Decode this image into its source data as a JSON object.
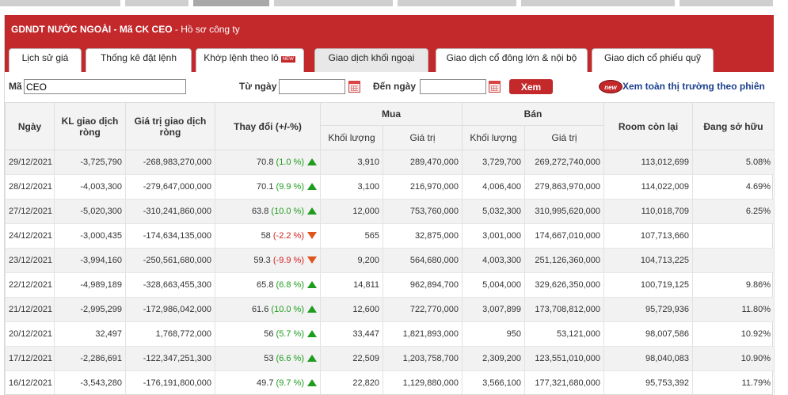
{
  "header": {
    "title": "GDNDT NƯỚC NGOÀI - Mã CK CEO",
    "subtitle": " - Hồ sơ công ty"
  },
  "tabs": [
    {
      "label": "Lịch sử giá",
      "active": false,
      "badge": ""
    },
    {
      "label": "Thống kê đặt lệnh",
      "active": false,
      "badge": ""
    },
    {
      "label": "Khớp lệnh theo lô",
      "active": false,
      "badge": "NEW"
    },
    {
      "label": "Giao dịch khối ngoại",
      "active": true,
      "badge": ""
    },
    {
      "label": "Giao dịch cổ đông lớn & nội bộ",
      "active": false,
      "badge": ""
    },
    {
      "label": "Giao dịch cổ phiếu quỹ",
      "active": false,
      "badge": ""
    }
  ],
  "filters": {
    "symbol_label": "Mã",
    "symbol_value": "CEO",
    "from_label": "Từ ngày",
    "from_value": "",
    "to_label": "Đến ngày",
    "to_value": "",
    "submit_label": "Xem",
    "new_badge": "new",
    "market_link": "Xem toàn thị trường theo phiên"
  },
  "table": {
    "headers": {
      "date": "Ngày",
      "net_volume": "KL giao dịch ròng",
      "net_value": "Giá trị giao dịch ròng",
      "change": "Thay đổi (+/-%)",
      "buy": "Mua",
      "sell": "Bán",
      "volume": "Khối lượng",
      "value": "Giá trị",
      "room": "Room còn lại",
      "holding": "Đang sở hữu"
    },
    "rows": [
      {
        "date": "29/12/2021",
        "net_vol": "-3,725,790",
        "net_val": "-268,983,270,000",
        "price": "70.8",
        "pct": "(1.0 %)",
        "dir": "up",
        "buy_vol": "3,910",
        "buy_val": "289,470,000",
        "sell_vol": "3,729,700",
        "sell_val": "269,272,740,000",
        "room": "113,012,699",
        "holding": "5.08%"
      },
      {
        "date": "28/12/2021",
        "net_vol": "-4,003,300",
        "net_val": "-279,647,000,000",
        "price": "70.1",
        "pct": "(9.9 %)",
        "dir": "up",
        "buy_vol": "3,100",
        "buy_val": "216,970,000",
        "sell_vol": "4,006,400",
        "sell_val": "279,863,970,000",
        "room": "114,022,009",
        "holding": "4.69%"
      },
      {
        "date": "27/12/2021",
        "net_vol": "-5,020,300",
        "net_val": "-310,241,860,000",
        "price": "63.8",
        "pct": "(10.0 %)",
        "dir": "up",
        "buy_vol": "12,000",
        "buy_val": "753,760,000",
        "sell_vol": "5,032,300",
        "sell_val": "310,995,620,000",
        "room": "110,018,709",
        "holding": "6.25%"
      },
      {
        "date": "24/12/2021",
        "net_vol": "-3,000,435",
        "net_val": "-174,634,135,000",
        "price": "58",
        "pct": "(-2.2 %)",
        "dir": "down",
        "buy_vol": "565",
        "buy_val": "32,875,000",
        "sell_vol": "3,001,000",
        "sell_val": "174,667,010,000",
        "room": "107,713,660",
        "holding": ""
      },
      {
        "date": "23/12/2021",
        "net_vol": "-3,994,160",
        "net_val": "-250,561,680,000",
        "price": "59.3",
        "pct": "(-9.9 %)",
        "dir": "down",
        "buy_vol": "9,200",
        "buy_val": "564,680,000",
        "sell_vol": "4,003,300",
        "sell_val": "251,126,360,000",
        "room": "104,713,225",
        "holding": ""
      },
      {
        "date": "22/12/2021",
        "net_vol": "-4,989,189",
        "net_val": "-328,663,455,300",
        "price": "65.8",
        "pct": "(6.8 %)",
        "dir": "up",
        "buy_vol": "14,811",
        "buy_val": "962,894,700",
        "sell_vol": "5,004,000",
        "sell_val": "329,626,350,000",
        "room": "100,719,125",
        "holding": "9.86%"
      },
      {
        "date": "21/12/2021",
        "net_vol": "-2,995,299",
        "net_val": "-172,986,042,000",
        "price": "61.6",
        "pct": "(10.0 %)",
        "dir": "up",
        "buy_vol": "12,600",
        "buy_val": "722,770,000",
        "sell_vol": "3,007,899",
        "sell_val": "173,708,812,000",
        "room": "95,729,936",
        "holding": "11.80%"
      },
      {
        "date": "20/12/2021",
        "net_vol": "32,497",
        "net_val": "1,768,772,000",
        "price": "56",
        "pct": "(5.7 %)",
        "dir": "up",
        "buy_vol": "33,447",
        "buy_val": "1,821,893,000",
        "sell_vol": "950",
        "sell_val": "53,121,000",
        "room": "98,007,586",
        "holding": "10.92%"
      },
      {
        "date": "17/12/2021",
        "net_vol": "-2,286,691",
        "net_val": "-122,347,251,300",
        "price": "53",
        "pct": "(6.6 %)",
        "dir": "up",
        "buy_vol": "22,509",
        "buy_val": "1,203,758,700",
        "sell_vol": "2,309,200",
        "sell_val": "123,551,010,000",
        "room": "98,040,083",
        "holding": "10.90%"
      },
      {
        "date": "16/12/2021",
        "net_vol": "-3,543,280",
        "net_val": "-176,191,800,000",
        "price": "49.7",
        "pct": "(9.7 %)",
        "dir": "up",
        "buy_vol": "22,820",
        "buy_val": "1,129,880,000",
        "sell_vol": "3,566,100",
        "sell_val": "177,321,680,000",
        "room": "95,753,392",
        "holding": "11.79%"
      }
    ]
  }
}
